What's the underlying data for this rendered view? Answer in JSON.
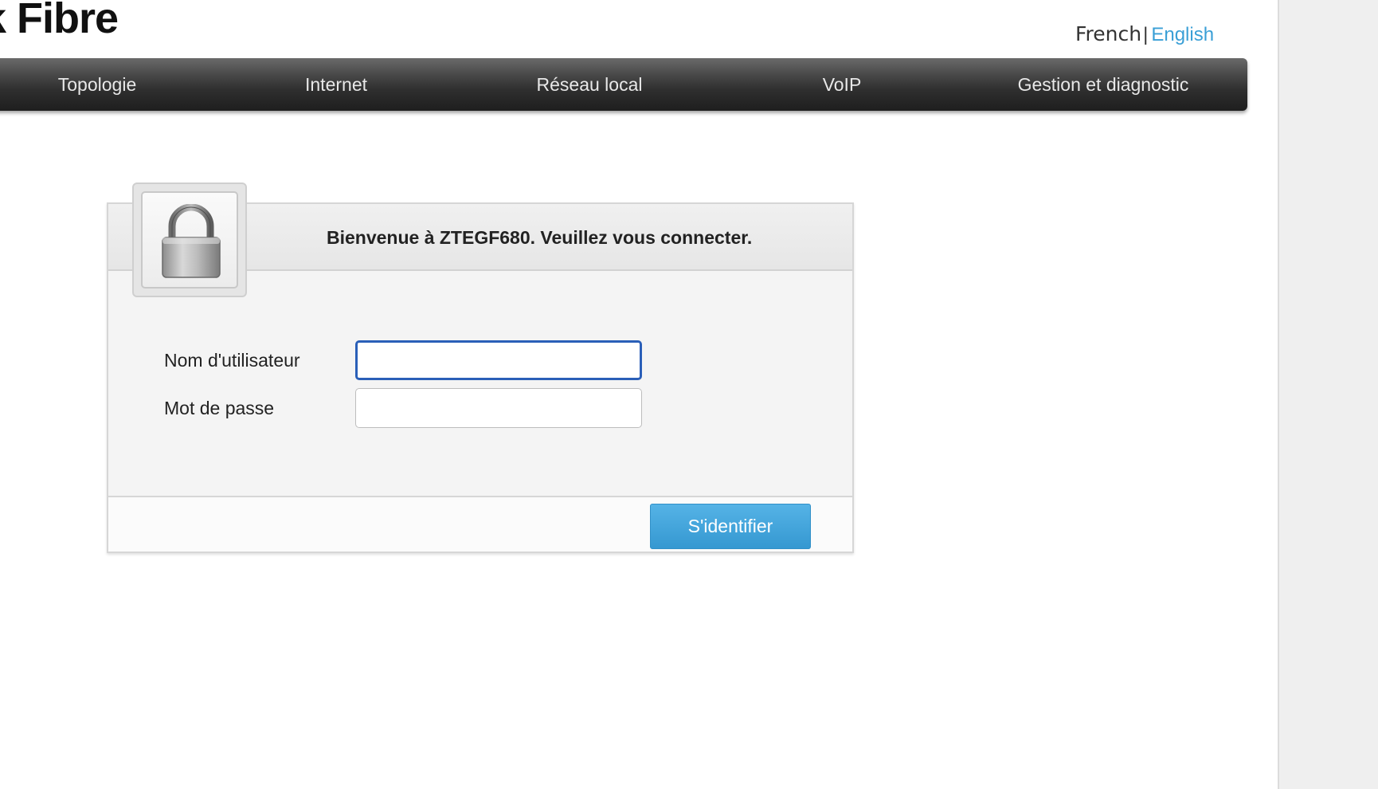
{
  "brand": {
    "text": "k Fibre"
  },
  "language": {
    "french": "French",
    "separator": "|",
    "english": "English",
    "active_color": "#3a9fd6"
  },
  "nav": {
    "items": [
      {
        "label": "Topologie"
      },
      {
        "label": "Internet"
      },
      {
        "label": "Réseau local"
      },
      {
        "label": "VoIP"
      },
      {
        "label": "Gestion et diagnostic"
      }
    ]
  },
  "login": {
    "title": "Bienvenue à ZTEGF680. Veuillez vous connecter.",
    "username_label": "Nom d'utilisateur",
    "username_value": "",
    "password_label": "Mot de passe",
    "password_value": "",
    "submit_label": "S'identifier",
    "lock_icon": "padlock-icon",
    "accent_color": "#3598d1",
    "focus_color": "#2a5fb8"
  }
}
